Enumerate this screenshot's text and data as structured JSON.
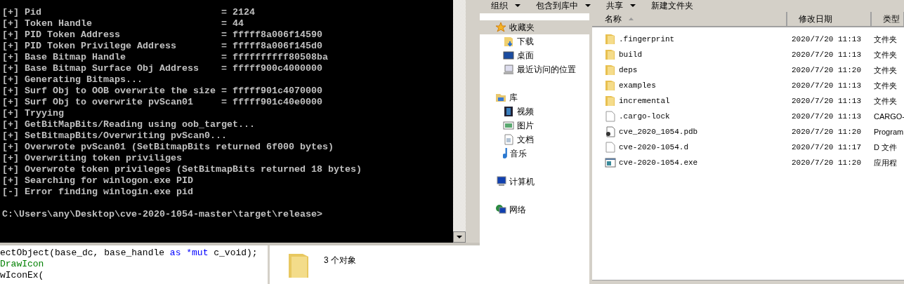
{
  "console": {
    "lines": [
      "[+] Pid                                = 2124",
      "[+] Token Handle                       = 44",
      "[+] PID Token Address                  = fffff8a006f14590",
      "[+] PID Token Privilege Address        = fffff8a006f145d0",
      "[+] Base Bitmap Handle                 = ffffffffff80508ba",
      "[+] Base Bitmap Surface Obj Address    = fffff900c4000000",
      "[+] Generating Bitmaps...",
      "[+] Surf Obj to OOB overwrite the size = fffff901c4070000",
      "[+] Surf Obj to overwrite pvScan01     = fffff901c40e0000",
      "[+] Tryying",
      "[+] GetBitMapBits/Reading using oob_target...",
      "[+] SetBitmapBits/Overwriting pvScan0...",
      "[+] Overwrote pvScan01 (SetBitmapBits returned 6f000 bytes)",
      "[+] Overwriting token priviliges",
      "[+] Overwrote token privileges (SetBitmapBits returned 18 bytes)",
      "[+] Searching for winlogon.exe PID",
      "[-] Error finding winlogin.exe pid"
    ],
    "prompt": "C:\\Users\\any\\Desktop\\cve-2020-1054-master\\target\\release>"
  },
  "code_editor": {
    "lines": [
      [
        {
          "text": "ectObject(base_dc, base_handle ",
          "kind": "plain"
        },
        {
          "text": "as *mut",
          "kind": "keyword"
        },
        {
          "text": " c_void);",
          "kind": "plain"
        }
      ],
      [
        {
          "text": "DrawIcon",
          "kind": "comment"
        }
      ],
      [
        {
          "text": "wIconEx(",
          "kind": "plain"
        }
      ]
    ]
  },
  "details_pane": {
    "count": "3 个对象"
  },
  "toolbar": {
    "items": [
      {
        "label": "组织",
        "dropdown": true
      },
      {
        "label": "包含到库中",
        "dropdown": true
      },
      {
        "label": "共享",
        "dropdown": true
      },
      {
        "label": "新建文件夹",
        "dropdown": false
      }
    ]
  },
  "navigation": [
    {
      "label": "收藏夹",
      "selected": true,
      "children": [
        {
          "label": "下载",
          "selected": false
        },
        {
          "label": "桌面",
          "selected": false
        },
        {
          "label": "最近访问的位置",
          "selected": false
        }
      ]
    },
    {
      "label": "库",
      "selected": false,
      "children": [
        {
          "label": "视频",
          "selected": false
        },
        {
          "label": "图片",
          "selected": false
        },
        {
          "label": "文档",
          "selected": false
        },
        {
          "label": "音乐",
          "selected": false
        }
      ]
    },
    {
      "label": "计算机",
      "selected": false
    },
    {
      "label": "网络",
      "selected": false
    }
  ],
  "file_list": {
    "columns": [
      "名称",
      "修改日期",
      "类型"
    ],
    "rows": [
      {
        "name": ".fingerprint",
        "modified": "2020/7/20 11:13",
        "type": "文件夹",
        "kind": "folder"
      },
      {
        "name": "build",
        "modified": "2020/7/20 11:13",
        "type": "文件夹",
        "kind": "folder"
      },
      {
        "name": "deps",
        "modified": "2020/7/20 11:20",
        "type": "文件夹",
        "kind": "folder"
      },
      {
        "name": "examples",
        "modified": "2020/7/20 11:13",
        "type": "文件夹",
        "kind": "folder"
      },
      {
        "name": "incremental",
        "modified": "2020/7/20 11:13",
        "type": "文件夹",
        "kind": "folder"
      },
      {
        "name": ".cargo-lock",
        "modified": "2020/7/20 11:13",
        "type": "CARGO-",
        "kind": "file"
      },
      {
        "name": "cve_2020_1054.pdb",
        "modified": "2020/7/20 11:20",
        "type": "Program",
        "kind": "pdb"
      },
      {
        "name": "cve-2020-1054.d",
        "modified": "2020/7/20 11:17",
        "type": "D 文件",
        "kind": "file"
      },
      {
        "name": "cve-2020-1054.exe",
        "modified": "2020/7/20 11:20",
        "type": "应用程",
        "kind": "exe"
      }
    ]
  }
}
